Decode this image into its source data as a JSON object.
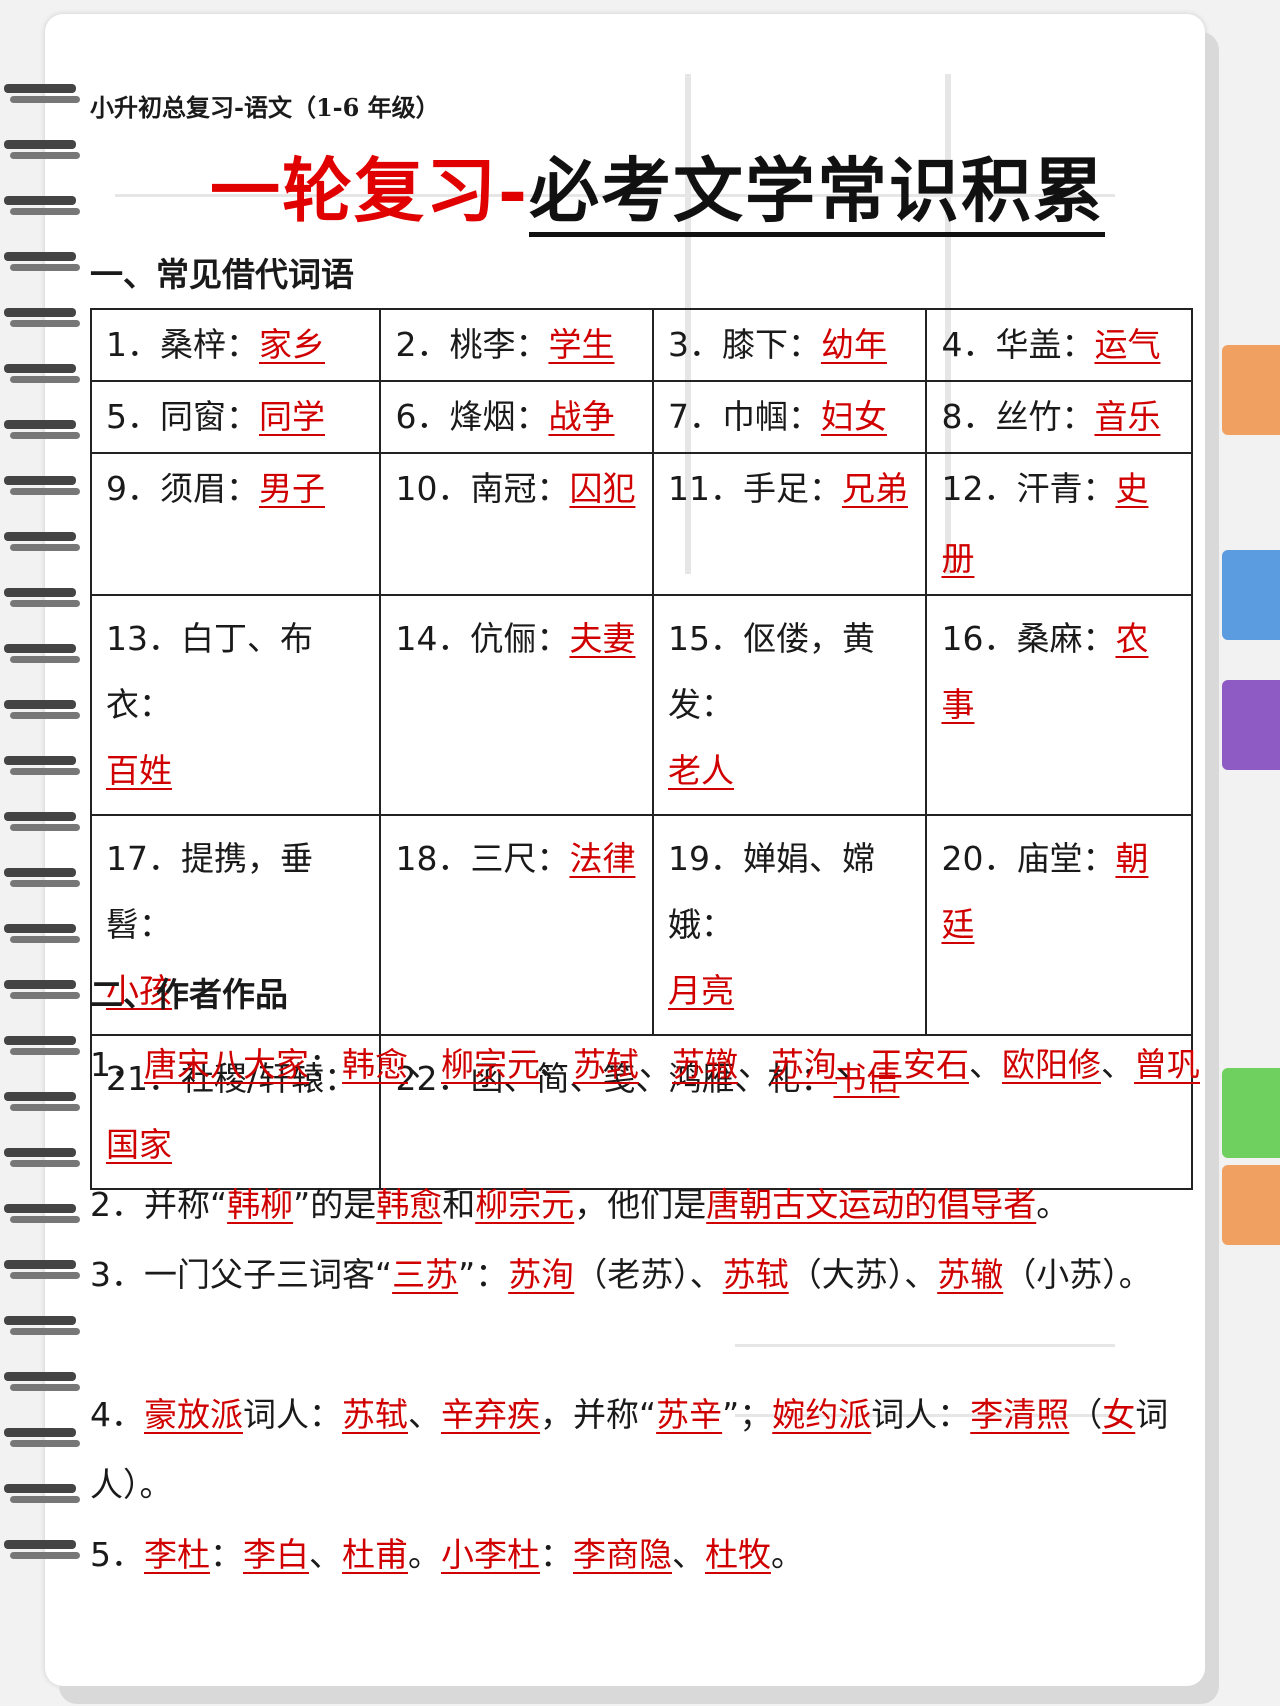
{
  "header": {
    "subtitle": "小升初总复习-语文（1-6 年级）",
    "title_red": "一轮复习-",
    "title_black": "必考文学常识积累"
  },
  "section1": {
    "heading": "一、常见借代词语",
    "items": [
      {
        "term": "1．桑梓：",
        "answer": "家乡"
      },
      {
        "term": "2．桃李：",
        "answer": "学生"
      },
      {
        "term": "3．膝下：",
        "answer": "幼年"
      },
      {
        "term": "4．华盖：",
        "answer": "运气"
      },
      {
        "term": "5．同窗：",
        "answer": "同学"
      },
      {
        "term": "6．烽烟：",
        "answer": "战争"
      },
      {
        "term": "7．巾帼：",
        "answer": "妇女"
      },
      {
        "term": "8．丝竹：",
        "answer": "音乐"
      },
      {
        "term": "9．须眉：",
        "answer": "男子"
      },
      {
        "term": "10．南冠：",
        "answer": "囚犯"
      },
      {
        "term": "11．手足：",
        "answer": "兄弟"
      },
      {
        "term": "12．汗青：",
        "answer": "史册"
      },
      {
        "term": "13．白丁、布衣：",
        "answer": "百姓"
      },
      {
        "term": "14．伉俪：",
        "answer": "夫妻"
      },
      {
        "term": "15．伛偻，黄发：",
        "answer": "老人"
      },
      {
        "term": "16．桑麻：",
        "answer": "农事"
      },
      {
        "term": "17．提携，垂髫：",
        "answer": "小孩"
      },
      {
        "term": "18．三尺：",
        "answer": "法律"
      },
      {
        "term": "19．婵娟、嫦娥：",
        "answer": "月亮"
      },
      {
        "term": "20．庙堂：",
        "answer": "朝廷"
      },
      {
        "term": "21．社稷/轩辕：",
        "answer": "国家"
      },
      {
        "term": "22．函、简、笺、鸿雁、札：",
        "answer": "书信"
      }
    ]
  },
  "section2": {
    "heading": "二、作者作品",
    "p1": [
      "1．",
      "唐宋八大家",
      "：",
      "韩愈",
      "、",
      "柳宗元",
      "、",
      "苏轼",
      "、",
      "苏辙",
      "、",
      "苏洵",
      "、",
      "王安石",
      "、",
      "欧阳修",
      "、",
      "曾巩"
    ],
    "p2": [
      "2．并称“",
      "韩柳",
      "”的是",
      "韩愈",
      "和",
      "柳宗元",
      "，他们是",
      "唐朝古文运动的倡导者",
      "。"
    ],
    "p3": [
      "3．一门父子三词客“",
      "三苏",
      "”：",
      "苏洵",
      "（老苏）、",
      "苏轼",
      "（大苏）、",
      "苏辙",
      "（小苏）。"
    ],
    "p4": [
      "4．",
      "豪放派",
      "词人：",
      "苏轼",
      "、",
      "辛弃疾",
      "，并称“",
      "苏辛",
      "”；",
      "婉约派",
      "词人：",
      "李清照",
      "（",
      "女",
      "词人）。"
    ],
    "p5": [
      "5．",
      "李杜",
      "：",
      "李白",
      "、",
      "杜甫",
      "。",
      "小李杜",
      "：",
      "李商隐",
      "、",
      "杜牧",
      "。"
    ]
  },
  "colors": {
    "answer": "#d00000",
    "text": "#1a1a1a",
    "tab_orange": "#f0a060",
    "tab_blue": "#5b9be0",
    "tab_purple": "#8e5bc4",
    "tab_green": "#6fd05f"
  }
}
